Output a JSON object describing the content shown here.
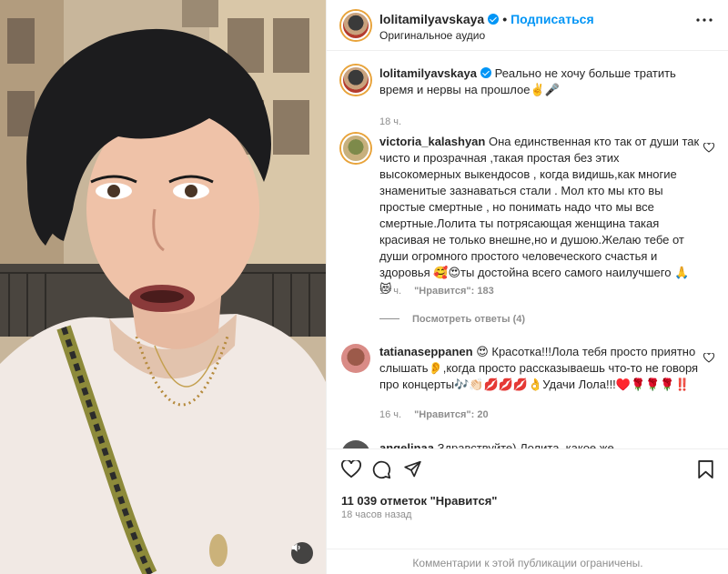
{
  "header": {
    "username": "lolitamilyavskaya",
    "separator": "•",
    "follow_label": "Подписаться",
    "subtitle": "Оригинальное аудио"
  },
  "caption": {
    "username": "lolitamilyavskaya",
    "text": "Реально не хочу больше тратить время и нервы на прошлое✌️🎤",
    "time": "18 ч."
  },
  "comments": [
    {
      "username": "victoria_kalashyan",
      "text": "Она единственная кто так от души так чисто и прозрачная ,такая простая без этих высокомерных выкендосов , когда видишь,как многие знаменитые зазнаваться стали . Мол кто мы кто вы простые смертные , но понимать надо что мы все смертные.Лолита ты потрясающая женщина такая красивая не только внешне,но и душою.Желаю тебе от души огромного простого человеческого счастья и здоровья 🥰😍ты достойна всего самого наилучшего 🙏😻",
      "time": "17 ч.",
      "likes": "\"Нравится\": 183",
      "replies": "Посмотреть ответы (4)"
    },
    {
      "username": "tatianaseppanen",
      "text": "😍 Красотка!!!Лола тебя просто приятно слышать👂,когда просто рассказываешь что-то не говоря про концерты🎶👏🏻💋💋💋👌Удачи Лола!!!♥️🌹🌹🌹‼️",
      "time": "16 ч.",
      "likes": "\"Нравится\": 20"
    },
    {
      "username": "angelinaa",
      "text": "Здравствуйте) Лолита, какое же…"
    }
  ],
  "actions": {
    "likes_count": "11 039 отметок \"Нравится\"",
    "time_ago": "18 часов назад",
    "comments_limited": "Комментарии к этой публикации ограничены."
  },
  "icons": {
    "more": "more-horizontal-icon",
    "like": "heart-icon",
    "comment": "comment-icon",
    "share": "share-icon",
    "save": "bookmark-icon",
    "mute": "speaker-icon"
  },
  "colors": {
    "accent": "#0095f6",
    "muted": "#8e8e8e",
    "text": "#262626"
  }
}
